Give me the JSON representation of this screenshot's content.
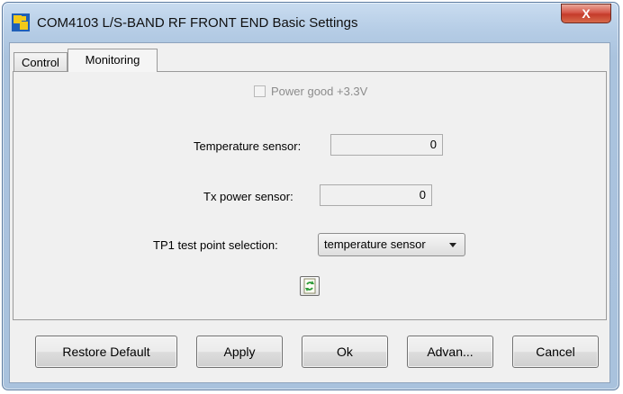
{
  "window": {
    "title": "COM4103 L/S-BAND RF FRONT END Basic Settings",
    "close_label": "X"
  },
  "tabs": [
    {
      "label": "Control",
      "selected": false
    },
    {
      "label": "Monitoring",
      "selected": true
    }
  ],
  "monitoring": {
    "power_good": {
      "label": "Power good +3.3V",
      "checked": false,
      "enabled": false
    },
    "temperature": {
      "label": "Temperature sensor:",
      "value": "0"
    },
    "tx_power": {
      "label": "Tx power sensor:",
      "value": "0"
    },
    "tp1": {
      "label": "TP1 test point selection:",
      "selected": "temperature sensor"
    },
    "refresh_icon": "refresh-icon"
  },
  "buttons": {
    "restore": "Restore Default",
    "apply": "Apply",
    "ok": "Ok",
    "advanced": "Advan...",
    "cancel": "Cancel"
  },
  "colors": {
    "frame": "#b6cde6",
    "close": "#c53b2a",
    "panel": "#f0f0f0",
    "refresh_green": "#2e9c3a"
  }
}
